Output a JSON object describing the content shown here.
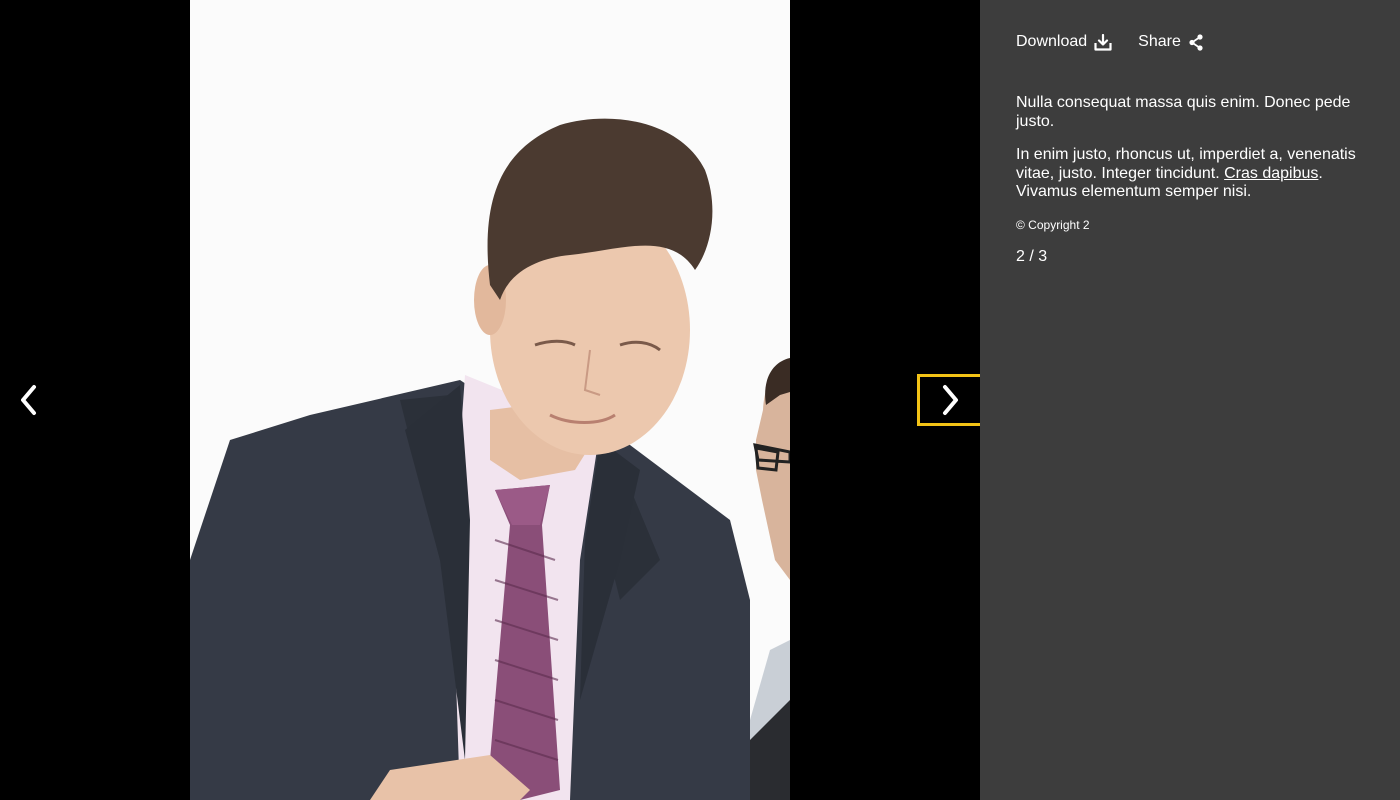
{
  "toolbar": {
    "download_label": "Download",
    "download_icon": "download-icon",
    "share_label": "Share",
    "share_icon": "share-icon"
  },
  "caption": {
    "paragraph1": "Nulla consequat massa quis enim. Donec pede justo.",
    "paragraph2_text": "In enim justo, rhoncus ut, imperdiet a, venenatis vitae, justo. Integer tincidunt. ",
    "paragraph2_link": "Cras dapibus",
    "paragraph2_after": ". Vivamus elementum semper nisi.",
    "copyright": "© Copyright 2"
  },
  "counter": "2 / 3",
  "navigation": {
    "prev_icon": "chevron-left-icon",
    "next_icon": "chevron-right-icon",
    "focus_color": "#f3c316"
  },
  "colors": {
    "stage_background": "#000000",
    "panel_background": "#3d3d3d",
    "text": "#ffffff"
  }
}
